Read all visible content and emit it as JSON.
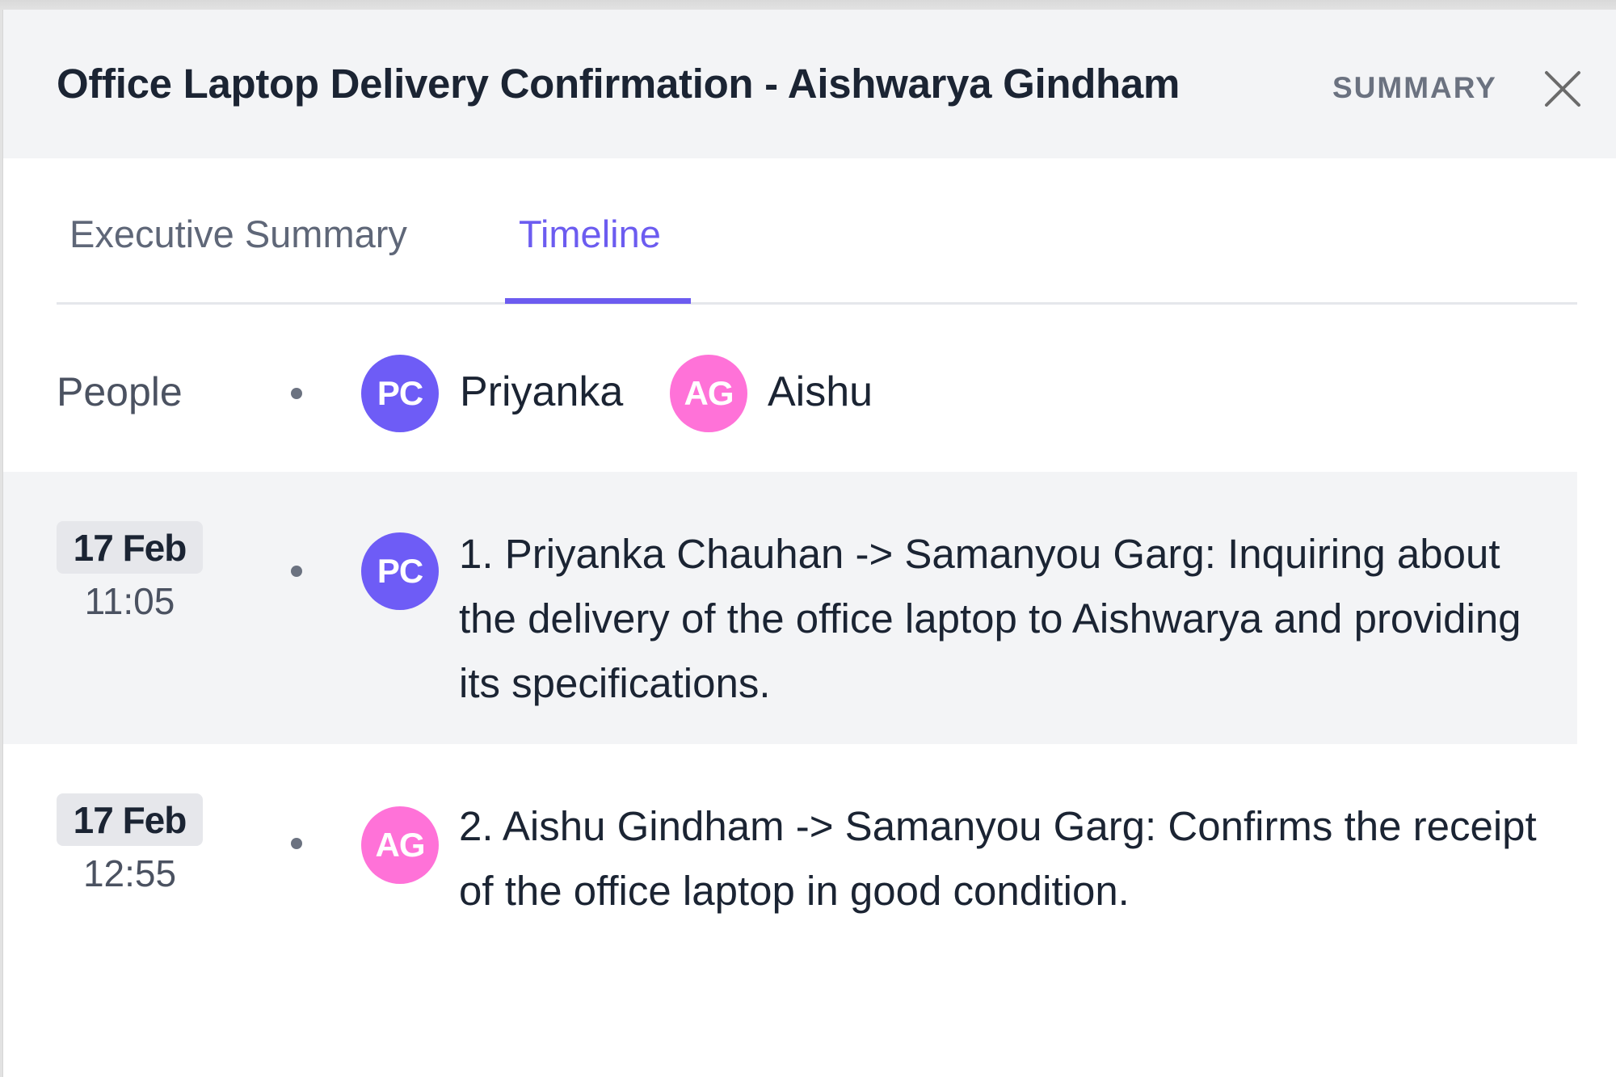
{
  "header": {
    "title": "Office Laptop Delivery Confirmation - Aishwarya Gindham",
    "summary_label": "SUMMARY",
    "close_icon": "close-icon"
  },
  "tabs": [
    {
      "label": "Executive Summary",
      "active": false
    },
    {
      "label": "Timeline",
      "active": true
    }
  ],
  "colors": {
    "accent": "#6c5cf0",
    "avatar_pc": "#6e5cf6",
    "avatar_ag": "#ff72d8",
    "highlight_row": "#f3f4f6"
  },
  "people": {
    "label": "People",
    "list": [
      {
        "initials": "PC",
        "name": "Priyanka",
        "color": "#6e5cf6"
      },
      {
        "initials": "AG",
        "name": "Aishu",
        "color": "#ff72d8"
      }
    ]
  },
  "timeline": [
    {
      "date": "17 Feb",
      "time": "11:05",
      "initials": "PC",
      "color": "#6e5cf6",
      "text": "1. Priyanka Chauhan -> Samanyou Garg: Inquiring about the delivery of the office laptop to Aishwarya and providing its specifications."
    },
    {
      "date": "17 Feb",
      "time": "12:55",
      "initials": "AG",
      "color": "#ff72d8",
      "text": "2. Aishu Gindham -> Samanyou Garg: Confirms the receipt of the office laptop in good condition."
    }
  ]
}
